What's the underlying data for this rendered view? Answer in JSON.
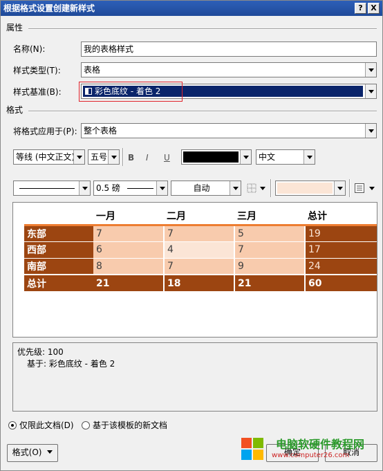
{
  "window": {
    "title": "根据格式设置创建新样式",
    "help_label": "?",
    "close_label": "X"
  },
  "properties": {
    "section_label": "属性",
    "name_label": "名称(N):",
    "name_value": "我的表格样式",
    "type_label": "样式类型(T):",
    "type_value": "表格",
    "based_on_label": "样式基准(B):",
    "based_on_value": "彩色底纹 - 着色 2"
  },
  "formatting": {
    "section_label": "格式",
    "apply_to_label": "将格式应用于(P):",
    "apply_to_value": "整个表格",
    "font_value": "等线 (中文正文)",
    "size_value": "五号",
    "bold_label": "B",
    "italic_label": "I",
    "underline_label": "U",
    "font_color": "#000000",
    "language_value": "中文",
    "line_weight_value": "0.5 磅",
    "border_color_value": "自动"
  },
  "preview_table": {
    "header": [
      "",
      "一月",
      "二月",
      "三月",
      "总计"
    ],
    "rows": [
      [
        "东部",
        "7",
        "7",
        "5",
        "19"
      ],
      [
        "西部",
        "6",
        "4",
        "7",
        "17"
      ],
      [
        "南部",
        "8",
        "7",
        "9",
        "24"
      ],
      [
        "总计",
        "21",
        "18",
        "21",
        "60"
      ]
    ],
    "colors": {
      "accent_dark": "#9c4511",
      "shade_light": "#f8cbad",
      "shade_lighter": "#fbe5d6",
      "header_rule": "#ed7d31"
    }
  },
  "description": {
    "line1": "优先级: 100",
    "line2": "基于: 彩色底纹 - 着色 2"
  },
  "options": {
    "only_this_doc": "仅限此文档(D)",
    "new_docs_from_template": "基于该模板的新文档"
  },
  "buttons": {
    "format_label": "格式(O)",
    "ok_label": "确定",
    "cancel_label": "取消"
  },
  "watermark": {
    "title": "电脑软硬件教程网",
    "url": "www.computer26.com"
  }
}
